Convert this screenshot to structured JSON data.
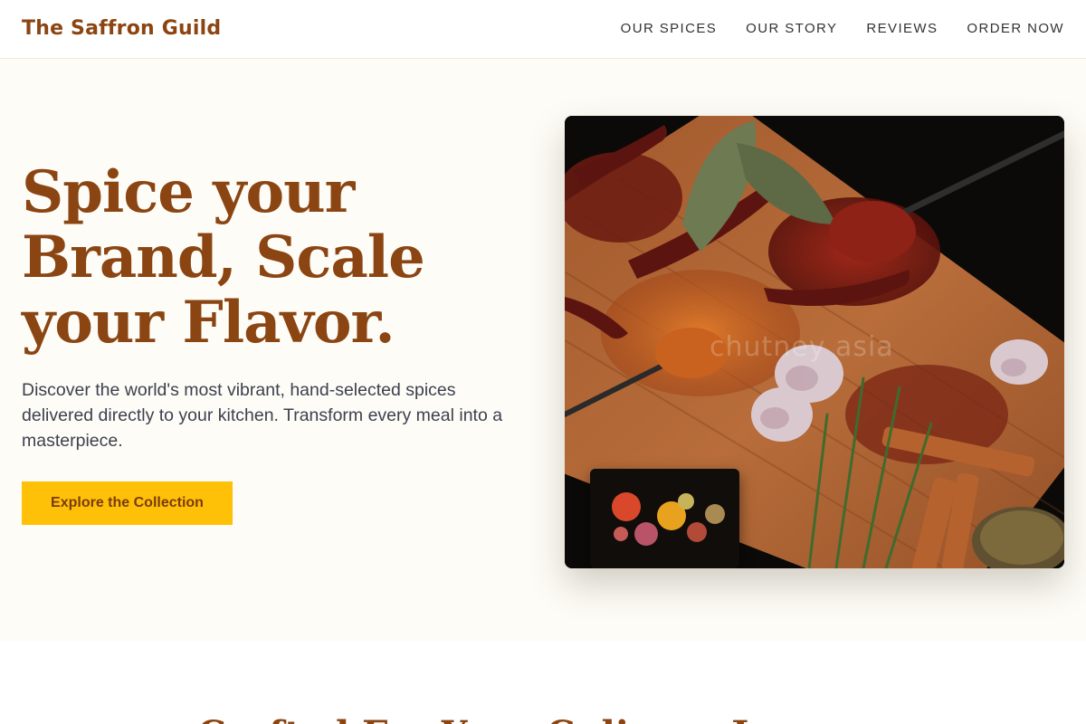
{
  "header": {
    "brand": "The Saffron Guild",
    "nav": [
      "OUR SPICES",
      "OUR STORY",
      "REVIEWS",
      "ORDER NOW"
    ]
  },
  "hero": {
    "headline_lines": [
      "Spice your",
      "Brand, Scale",
      "your Flavor."
    ],
    "subtitle": "Discover the world's most vibrant, hand-selected spices delivered directly to your kitchen. Transform every meal into a masterpiece.",
    "cta_label": "Explore the Collection",
    "image_watermark": "chutney asia"
  },
  "next_section": {
    "title_partial": "Crafted For Your Culinary Journey"
  },
  "colors": {
    "brand": "#8b4513",
    "accent": "#ffc107",
    "hero_bg": "#fdfcf6",
    "text": "#3d4150"
  }
}
